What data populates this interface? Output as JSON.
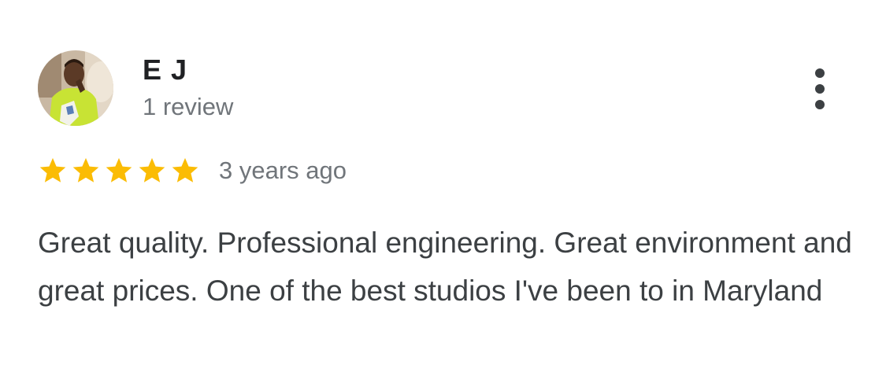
{
  "review": {
    "author": {
      "name": "E J",
      "review_count": "1 review",
      "avatar_icon": "user-avatar-photo"
    },
    "rating": 5,
    "rating_max": 5,
    "star_color": "#fbbc04",
    "date": "3 years ago",
    "text": "Great quality. Professional engineering. Great environment and great prices. One of the best studios I've been to in Maryland",
    "menu_icon": "more-vert-icon"
  }
}
